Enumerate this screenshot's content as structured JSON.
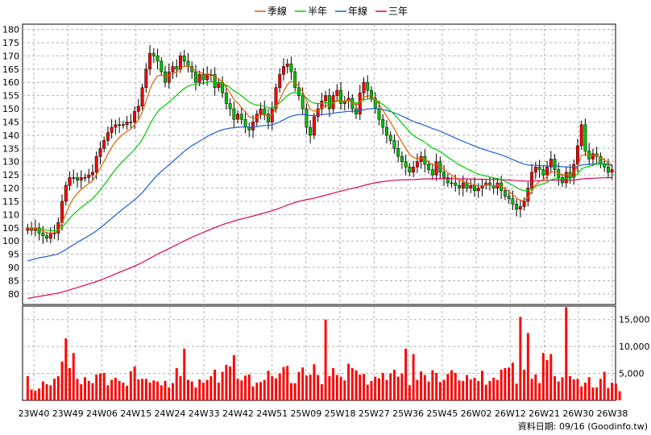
{
  "chart_data": [
    {
      "type": "candlestick",
      "ylim": [
        76,
        182
      ],
      "y_ticks": [
        80,
        85,
        90,
        95,
        100,
        105,
        110,
        115,
        120,
        125,
        130,
        135,
        140,
        145,
        150,
        155,
        160,
        165,
        170,
        175,
        180
      ],
      "x_tick_labels": [
        "23W40",
        "23W49",
        "24W06",
        "24W15",
        "24W24",
        "24W33",
        "24W42",
        "24W51",
        "25W09",
        "25W18",
        "25W27",
        "25W36",
        "25W45",
        "26W02",
        "26W12",
        "26W21",
        "26W30",
        "26W38"
      ],
      "grid": true,
      "legend": [
        "季線",
        "半年",
        "年線",
        "三年"
      ],
      "legend_position": "top-center",
      "colors": {
        "up": "#ff0000",
        "down": "#00c000",
        "quarter": "#e06000",
        "half": "#00cc00",
        "year": "#1e5bd8",
        "three_year": "#e0005a"
      },
      "close": [
        105,
        104,
        105,
        103,
        102,
        101,
        103,
        103,
        107,
        115,
        121,
        124,
        124,
        123,
        124,
        124,
        125,
        126,
        132,
        135,
        138,
        141,
        143,
        144,
        144,
        144,
        145,
        145,
        149,
        151,
        158,
        165,
        171,
        170,
        168,
        164,
        160,
        164,
        166,
        165,
        170,
        168,
        166,
        164,
        160,
        163,
        161,
        163,
        163,
        158,
        160,
        156,
        152,
        150,
        146,
        148,
        146,
        143,
        142,
        145,
        148,
        150,
        148,
        145,
        150,
        158,
        163,
        166,
        167,
        164,
        158,
        155,
        150,
        143,
        140,
        147,
        150,
        153,
        155,
        150,
        155,
        157,
        152,
        153,
        154,
        150,
        148,
        156,
        160,
        157,
        154,
        150,
        146,
        143,
        140,
        138,
        135,
        132,
        130,
        128,
        126,
        128,
        130,
        132,
        129,
        127,
        125,
        130,
        126,
        124,
        122,
        122,
        121,
        120,
        122,
        120,
        121,
        119,
        120,
        121,
        122,
        121,
        120,
        122,
        119,
        117,
        116,
        114,
        112,
        113,
        115,
        120,
        126,
        128,
        127,
        125,
        128,
        131,
        127,
        124,
        122,
        126,
        124,
        129,
        136,
        144,
        134,
        131,
        133,
        132,
        129,
        128,
        126,
        127
      ],
      "vol_ylim": [
        0,
        17500
      ],
      "vol_y_ticks": [
        5000,
        10000,
        15000
      ],
      "volume": [
        4500,
        2000,
        1800,
        2200,
        3500,
        3000,
        2800,
        4000,
        4500,
        7200,
        11500,
        6000,
        8800,
        4000,
        3000,
        4300,
        3600,
        3200,
        4800,
        5000,
        5100,
        2800,
        3800,
        4200,
        3600,
        3300,
        2700,
        5400,
        6300,
        3900,
        4000,
        4000,
        3300,
        3700,
        3500,
        2800,
        3600,
        2400,
        3200,
        6000,
        4500,
        9600,
        3800,
        3500,
        2400,
        3900,
        3300,
        3800,
        4500,
        5700,
        3300,
        5300,
        6600,
        6300,
        8400,
        4000,
        3700,
        4600,
        4800,
        2600,
        3300,
        3400,
        3800,
        5500,
        4500,
        4100,
        5000,
        6200,
        6400,
        3200,
        3200,
        5300,
        6100,
        4600,
        4800,
        6700,
        4700,
        3000,
        15000,
        4500,
        6000,
        4700,
        4400,
        3700,
        6800,
        6000,
        5600,
        4800,
        4900,
        2900,
        3600,
        4400,
        4100,
        5100,
        3800,
        5000,
        5700,
        4400,
        5000,
        9600,
        2800,
        8600,
        3800,
        5400,
        4700,
        3500,
        5600,
        5100,
        3400,
        3800,
        4900,
        5600,
        5100,
        3700,
        3600,
        4700,
        3900,
        4200,
        3600,
        5500,
        2900,
        3600,
        4200,
        3800,
        5700,
        6000,
        6100,
        7000,
        3100,
        15500,
        5700,
        12500,
        4000,
        4800,
        3200,
        8800,
        7500,
        8600,
        4500,
        3500,
        4300,
        17300,
        4500,
        3900,
        4000,
        2600,
        3300,
        4300,
        2400,
        2400,
        4000,
        5300,
        2300,
        3300,
        3100,
        1700
      ]
    }
  ],
  "footer": "資料日期: 09/16  (Goodinfo.tw)"
}
